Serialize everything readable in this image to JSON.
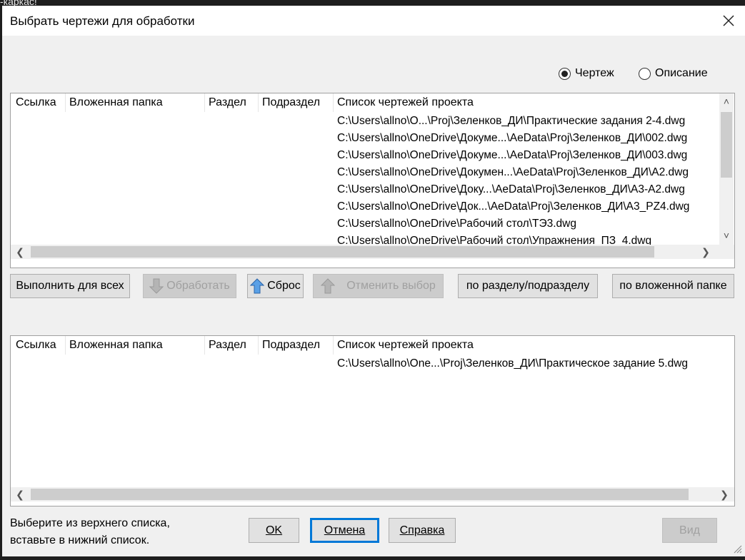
{
  "background": {
    "text": "-каркас!"
  },
  "dialog": {
    "title": "Выбрать чертежи для обработки",
    "close_icon": "close-icon"
  },
  "mode": {
    "options": [
      {
        "label": "Чертеж",
        "selected": true
      },
      {
        "label": "Описание",
        "selected": false
      }
    ]
  },
  "columns": [
    "Ссылка",
    "Вложенная папка",
    "Раздел",
    "Подраздел",
    "Список чертежей проекта"
  ],
  "top_list": {
    "rows": [
      "C:\\Users\\allno\\O...\\Proj\\Зеленков_ДИ\\Практические задания 2-4.dwg",
      "C:\\Users\\allno\\OneDrive\\Докуме...\\AeData\\Proj\\Зеленков_ДИ\\002.dwg",
      "C:\\Users\\allno\\OneDrive\\Докуме...\\AeData\\Proj\\Зеленков_ДИ\\003.dwg",
      "C:\\Users\\allno\\OneDrive\\Докумен...\\AeData\\Proj\\Зеленков_ДИ\\А2.dwg",
      "C:\\Users\\allno\\OneDrive\\Доку...\\AeData\\Proj\\Зеленков_ДИ\\А3-А2.dwg",
      "C:\\Users\\allno\\OneDrive\\Док...\\AeData\\Proj\\Зеленков_ДИ\\А3_PZ4.dwg",
      "C:\\Users\\allno\\OneDrive\\Рабочий стол\\ТЭ3.dwg",
      "C:\\Users\\allno\\OneDrive\\Рабочий стол\\Упражнения_ПЗ_4.dwg"
    ]
  },
  "actions": {
    "run_all": "Выполнить для всех",
    "process": "Обработать",
    "reset": "Сброс",
    "deselect": "Отменить выбор",
    "by_section": "по разделу/подразделу",
    "by_folder": "по вложенной папке"
  },
  "bottom_list": {
    "rows": [
      "C:\\Users\\allno\\One...\\Proj\\Зеленков_ДИ\\Практическое задание 5.dwg"
    ]
  },
  "footer": {
    "hint_line1": "Выберите из верхнего списка,",
    "hint_line2": "вставьте в нижний список.",
    "ok": "OK",
    "cancel": "Отмена",
    "help": "Справка",
    "view": "Вид"
  },
  "colors": {
    "focus": "#0078d7",
    "window": "#f0f0f0",
    "arrow_blue": "#3a7bd5"
  }
}
